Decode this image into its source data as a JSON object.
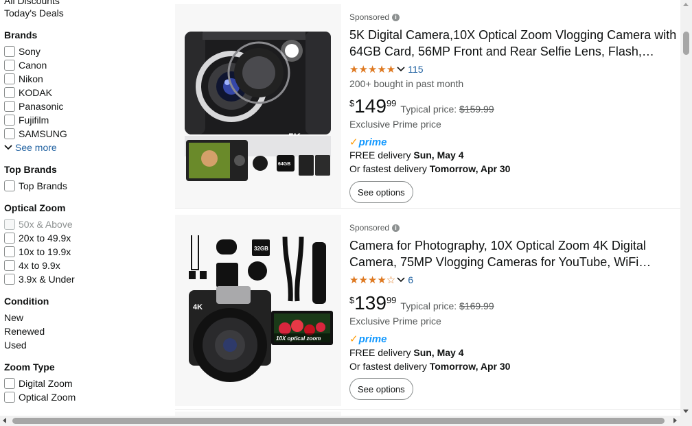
{
  "sidebar": {
    "top_links": [
      "All Discounts",
      "Today's Deals"
    ],
    "brands": {
      "heading": "Brands",
      "items": [
        "Sony",
        "Canon",
        "Nikon",
        "KODAK",
        "Panasonic",
        "Fujifilm",
        "SAMSUNG"
      ],
      "see_more": "See more"
    },
    "top_brands": {
      "heading": "Top Brands",
      "items": [
        "Top Brands"
      ]
    },
    "optical_zoom": {
      "heading": "Optical Zoom",
      "items": [
        "50x & Above",
        "20x to 49.9x",
        "10x to 19.9x",
        "4x to 9.9x",
        "3.9x & Under"
      ]
    },
    "condition": {
      "heading": "Condition",
      "items": [
        "New",
        "Renewed",
        "Used"
      ]
    },
    "zoom_type": {
      "heading": "Zoom Type",
      "items": [
        "Digital Zoom",
        "Optical Zoom"
      ]
    }
  },
  "results": [
    {
      "sponsored": "Sponsored",
      "title": "5K Digital Camera,10X Optical Zoom Vlogging Camera with 64GB Card, 56MP Front and Rear Selfie Lens, Flash,…",
      "rating": 4.5,
      "stars": "★★★★★",
      "review_count": "115",
      "bought": "200+ bought in past month",
      "price_symbol": "$",
      "price_whole": "149",
      "price_fraction": "99",
      "typical_label": "Typical price:",
      "typical_price": "$159.99",
      "exclusive": "Exclusive Prime price",
      "prime": "prime",
      "delivery_prefix": "FREE delivery ",
      "delivery_date": "Sun, May 4",
      "fastest_prefix": "Or fastest delivery ",
      "fastest_date": "Tomorrow, Apr 30",
      "button": "See options",
      "image_labels": [
        "5K",
        "2K",
        "64GB"
      ]
    },
    {
      "sponsored": "Sponsored",
      "title": "Camera for Photography, 10X Optical Zoom 4K Digital Camera, 75MP Vlogging Cameras for YouTube, WiFi…",
      "rating": 3.5,
      "stars": "★★★★☆",
      "review_count": "6",
      "price_symbol": "$",
      "price_whole": "139",
      "price_fraction": "99",
      "typical_label": "Typical price:",
      "typical_price": "$169.99",
      "exclusive": "Exclusive Prime price",
      "prime": "prime",
      "delivery_prefix": "FREE delivery ",
      "delivery_date": "Sun, May 4",
      "fastest_prefix": "Or fastest delivery ",
      "fastest_date": "Tomorrow, Apr 30",
      "button": "See options",
      "image_labels": [
        "32GB",
        "4K",
        "10X optical zoom"
      ]
    }
  ],
  "colors": {
    "link": "#2162a1",
    "star": "#de7921",
    "prime_blue": "#1399ff",
    "prime_check": "#ff9900"
  }
}
